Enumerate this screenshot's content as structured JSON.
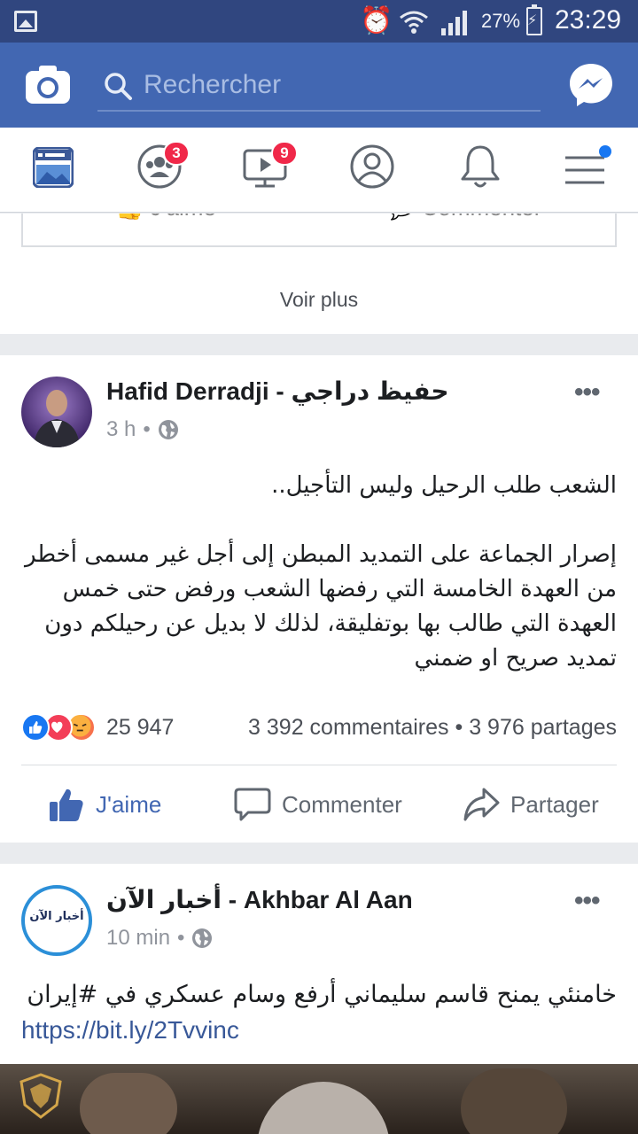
{
  "status_bar": {
    "battery_percent": "27%",
    "time": "23:29"
  },
  "search": {
    "placeholder": "Rechercher"
  },
  "nav": {
    "groups_badge": "3",
    "watch_badge": "9"
  },
  "prev_post": {
    "like_label": "J'aime",
    "comment_label": "Commenter",
    "see_more": "Voir plus"
  },
  "post1": {
    "author": "Hafid Derradji - حفيظ دراجي",
    "time": "3 h",
    "text": "الشعب طلب الرحيل وليس التأجيل..\n\nإصرار الجماعة على التمديد المبطن إلى أجل غير مسمى أخطر من العهدة الخامسة التي رفضها الشعب ورفض حتى خمس العهدة التي طالب بها بوتفليقة، لذلك لا بديل عن رحيلكم دون تمديد صريح او ضمني",
    "reaction_count": "25 947",
    "comments": "3 392 commentaires",
    "shares": "3 976 partages",
    "like_label": "J'aime",
    "comment_label": "Commenter",
    "share_label": "Partager"
  },
  "post2": {
    "author": "أخبار الآن - Akhbar Al Aan",
    "avatar_text": "أخبار الآن",
    "time": "10 min",
    "text": "خامنئي يمنح قاسم سليماني أرفع وسام عسكري في #إيران",
    "link": "https://bit.ly/2Tvvinc"
  },
  "colors": {
    "status_bar": "#30467f",
    "top_bar": "#4267b2",
    "badge": "#f02849",
    "link": "#385898"
  }
}
